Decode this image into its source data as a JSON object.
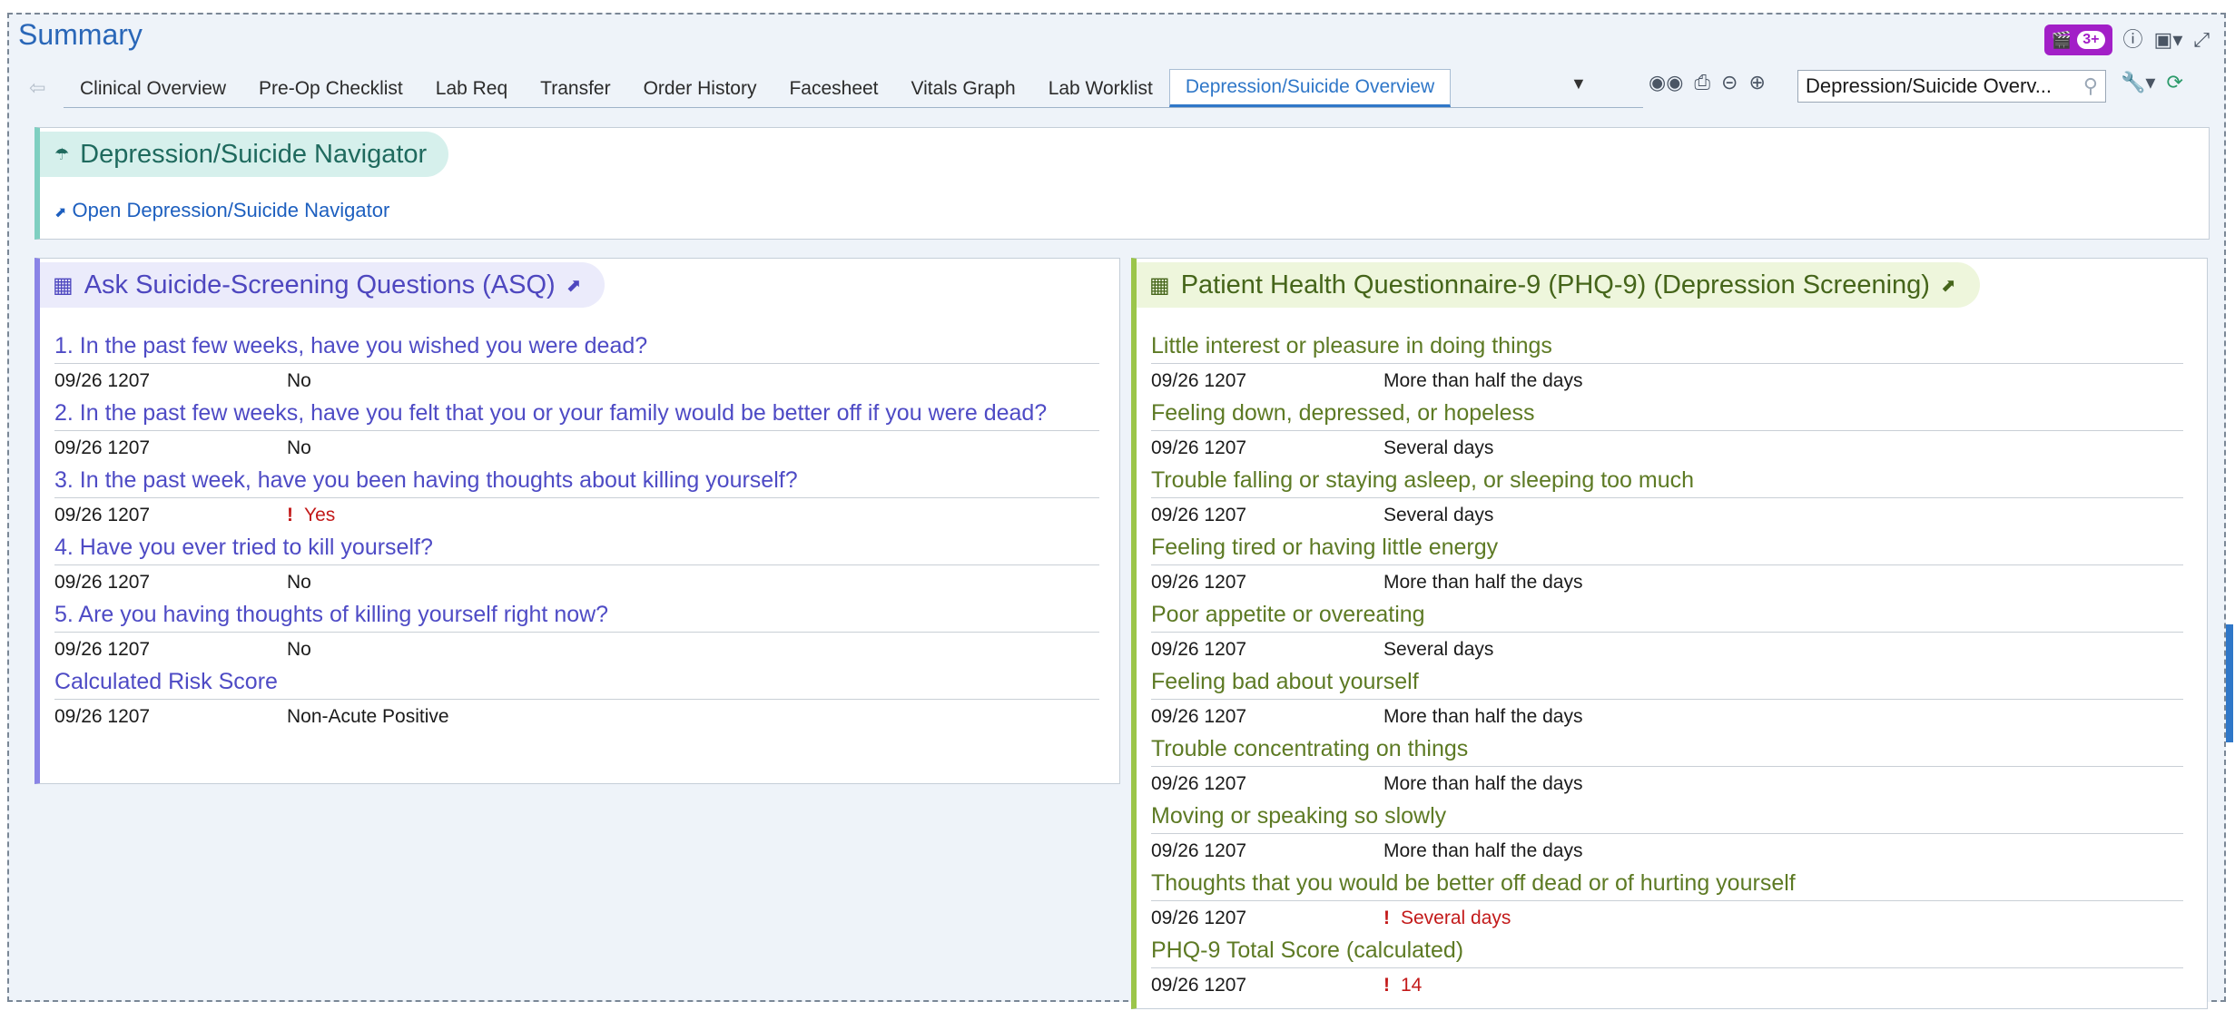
{
  "app": {
    "title": "Summary",
    "badge_label": "3+"
  },
  "tabs": [
    {
      "label": "Clinical Overview",
      "active": false
    },
    {
      "label": "Pre-Op Checklist",
      "active": false
    },
    {
      "label": "Lab Req",
      "active": false
    },
    {
      "label": "Transfer",
      "active": false
    },
    {
      "label": "Order History",
      "active": false
    },
    {
      "label": "Facesheet",
      "active": false
    },
    {
      "label": "Vitals Graph",
      "active": false
    },
    {
      "label": "Lab Worklist",
      "active": false
    },
    {
      "label": "Depression/Suicide Overview",
      "active": true
    }
  ],
  "search": {
    "value": "Depression/Suicide Overv..."
  },
  "navigator": {
    "title": "Depression/Suicide Navigator",
    "link": "Open Depression/Suicide Navigator"
  },
  "asq": {
    "title": "Ask Suicide-Screening Questions (ASQ)",
    "items": [
      {
        "question": "1. In the past few weeks, have you wished you were dead?",
        "date": "09/26 1207",
        "answer": "No",
        "flag": false
      },
      {
        "question": "2. In the past few weeks, have you felt that you or your family would be better off if you were dead?",
        "date": "09/26 1207",
        "answer": "No",
        "flag": false
      },
      {
        "question": "3. In the past week, have you been having thoughts about killing yourself?",
        "date": "09/26 1207",
        "answer": "Yes",
        "flag": true
      },
      {
        "question": "4. Have you ever tried to kill yourself?",
        "date": "09/26 1207",
        "answer": "No",
        "flag": false
      },
      {
        "question": "5. Are you having thoughts of killing yourself right now?",
        "date": "09/26 1207",
        "answer": "No",
        "flag": false
      },
      {
        "question": "Calculated Risk Score",
        "date": "09/26 1207",
        "answer": "Non-Acute Positive",
        "flag": false
      }
    ]
  },
  "phq": {
    "title": "Patient Health Questionnaire-9 (PHQ-9) (Depression Screening)",
    "items": [
      {
        "question": "Little interest or pleasure in doing things",
        "date": "09/26 1207",
        "answer": "More than half the days",
        "flag": false
      },
      {
        "question": "Feeling down, depressed, or hopeless",
        "date": "09/26 1207",
        "answer": "Several days",
        "flag": false
      },
      {
        "question": "Trouble falling or staying asleep, or sleeping too much",
        "date": "09/26 1207",
        "answer": "Several days",
        "flag": false
      },
      {
        "question": "Feeling tired or having little energy",
        "date": "09/26 1207",
        "answer": "More than half the days",
        "flag": false
      },
      {
        "question": "Poor appetite or overeating",
        "date": "09/26 1207",
        "answer": "Several days",
        "flag": false
      },
      {
        "question": "Feeling bad about yourself",
        "date": "09/26 1207",
        "answer": "More than half the days",
        "flag": false
      },
      {
        "question": "Trouble concentrating on things",
        "date": "09/26 1207",
        "answer": "More than half the days",
        "flag": false
      },
      {
        "question": "Moving or speaking so slowly",
        "date": "09/26 1207",
        "answer": "More than half the days",
        "flag": false
      },
      {
        "question": "Thoughts that you would be better off dead or of hurting yourself",
        "date": "09/26 1207",
        "answer": "Several days",
        "flag": true
      },
      {
        "question": "PHQ-9 Total Score (calculated)",
        "date": "09/26 1207",
        "answer": "14",
        "flag": true
      }
    ]
  },
  "icons": {
    "back": "back-arrow-icon",
    "binoculars": "binoculars-icon",
    "print": "print-icon",
    "zoom_out": "zoom-out-icon",
    "zoom_in": "zoom-in-icon",
    "search": "search-icon",
    "wrench": "wrench-icon",
    "refresh": "refresh-icon",
    "help": "help-icon",
    "window": "window-icon",
    "expand": "expand-icon",
    "grid": "grid-icon",
    "external_link": "external-link-icon",
    "navigator": "navigator-icon",
    "alert": "alert-icon"
  },
  "colors": {
    "title_blue": "#2a67b8",
    "active_tab": "#2f77c8",
    "asq_accent": "#8a84e6",
    "phq_accent": "#9bc54a",
    "navigator_accent": "#7fcfc1",
    "alert_red": "#c31a1a",
    "badge_purple": "#a21fc7"
  }
}
